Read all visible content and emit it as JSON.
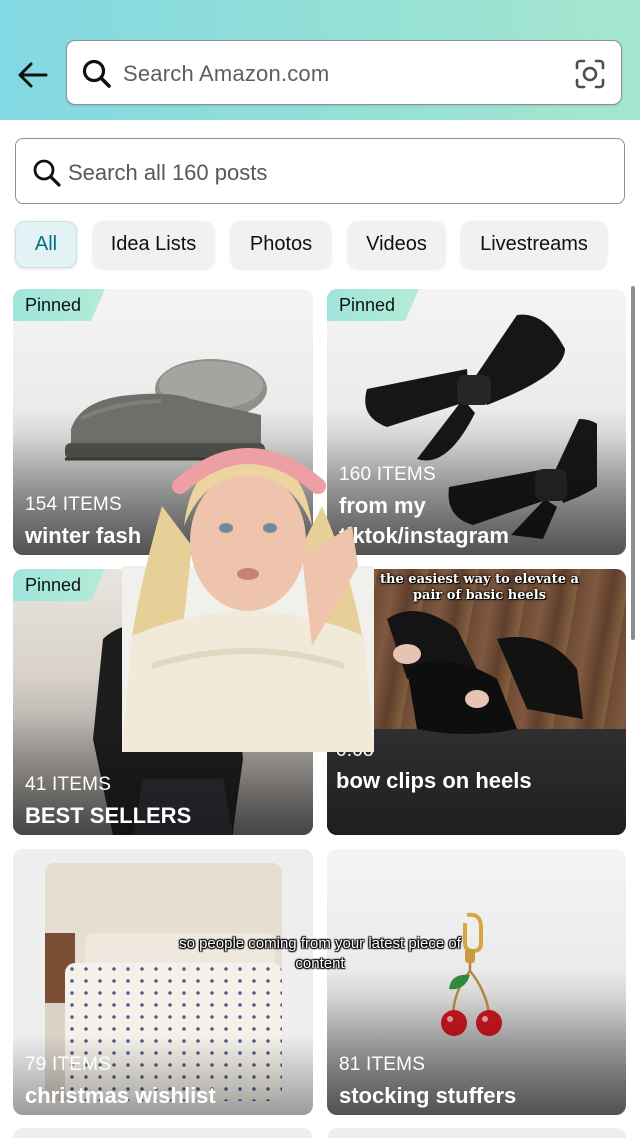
{
  "header": {
    "back_icon": "arrow-left-icon",
    "search_placeholder": "Search Amazon.com",
    "camera_icon": "camera-scan-icon",
    "mic_icon": "microphone-icon",
    "gradient": [
      "#82d8e3",
      "#a5e6ce"
    ]
  },
  "post_search": {
    "placeholder": "Search all 160 posts"
  },
  "filters": [
    {
      "label": "All",
      "active": true
    },
    {
      "label": "Idea Lists",
      "active": false
    },
    {
      "label": "Photos",
      "active": false
    },
    {
      "label": "Videos",
      "active": false
    },
    {
      "label": "Livestreams",
      "active": false
    }
  ],
  "cards": [
    {
      "pinned": "Pinned",
      "count": "154 ITEMS",
      "title": "winter fash"
    },
    {
      "pinned": "Pinned",
      "count": "160 ITEMS",
      "title_line1": "from my",
      "title_line2": "tiktok/instagram"
    },
    {
      "pinned": "Pinned",
      "count": "41 ITEMS",
      "title": "BEST SELLERS"
    },
    {
      "duration": "0:08",
      "title": "bow clips on heels",
      "overlay_caption": "the easiest way to elevate a pair of basic heels"
    },
    {
      "count": "79 ITEMS",
      "title": "christmas wishlist"
    },
    {
      "count": "81 ITEMS",
      "title": "stocking stuffers"
    }
  ],
  "video_subtitle": "so people coming from your latest piece of content",
  "colors": {
    "accent": "#007185",
    "pinned_tag": "#9fe4dc",
    "chip_bg": "#f0f2f2"
  }
}
